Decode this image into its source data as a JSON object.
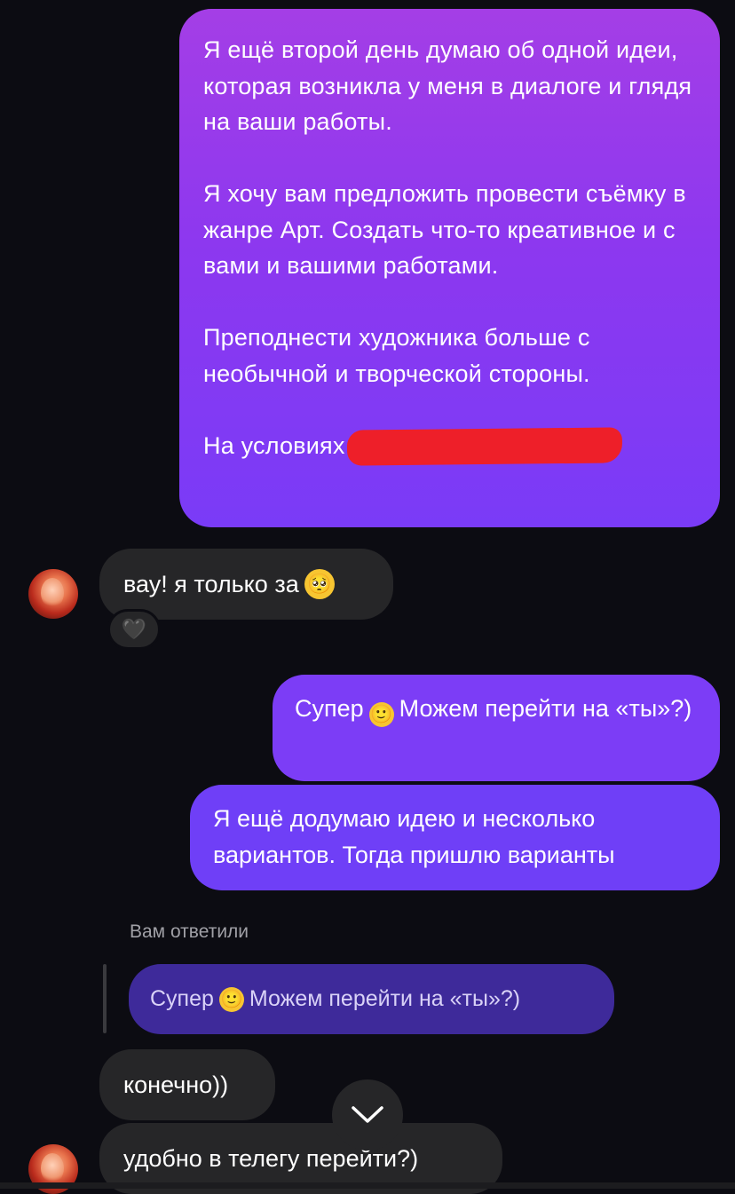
{
  "messages": {
    "outgoing_1": {
      "paragraphs": [
        "Я ещё второй день думаю об одной идеи, которая возникла у меня в диалоге и глядя на ваши работы.",
        "Я хочу вам предложить провести съёмку в жанре Арт. Создать что-то креативное и с вами и вашими работами.",
        "Преподнести художника больше с необычной и творческой стороны."
      ],
      "last_line_prefix": "На условиях"
    },
    "incoming_1": {
      "text": "вау! я только за",
      "emoji": "pleading-face"
    },
    "incoming_1_reaction": {
      "emoji": "black-heart"
    },
    "outgoing_2": {
      "text_before": "Супер",
      "emoji": "slightly-smiling-face",
      "text_after": "Можем перейти на «ты»?)"
    },
    "outgoing_3": {
      "text": "Я ещё додумаю идею и несколько вариантов. Тогда пришлю варианты"
    },
    "reply": {
      "label": "Вам ответили",
      "quote_before": "Супер",
      "quote_emoji": "slightly-smiling-face",
      "quote_after": "Можем перейти на «ты»?)"
    },
    "incoming_2": {
      "text": "конечно))"
    },
    "incoming_3": {
      "text": "удобно в телегу перейти?)"
    }
  },
  "colors": {
    "background": "#0c0c12",
    "incoming_bubble": "#262628",
    "outgoing_gradient_top": "#a43ee6",
    "outgoing_gradient_bottom": "#7a3bf7",
    "outgoing_solid": "#7c3df6",
    "reply_quote": "#3e2a9a",
    "redaction": "#ee1f29"
  },
  "controls": {
    "scroll_down_icon": "chevron-down-icon"
  }
}
